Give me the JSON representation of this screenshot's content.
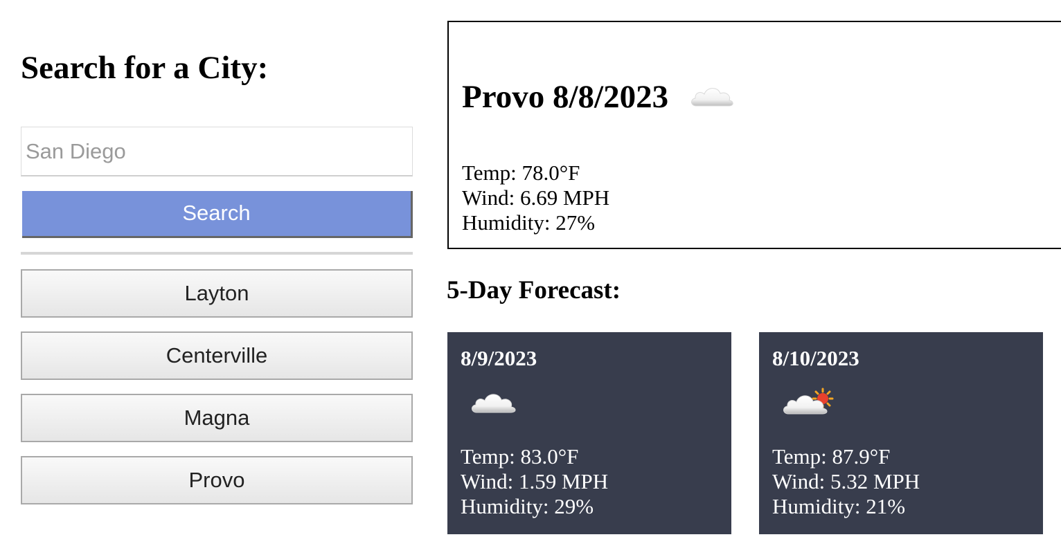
{
  "search": {
    "title": "Search for a City:",
    "placeholder": "San Diego",
    "value": "",
    "button_label": "Search"
  },
  "history": [
    {
      "label": "Layton"
    },
    {
      "label": "Centerville"
    },
    {
      "label": "Magna"
    },
    {
      "label": "Provo"
    }
  ],
  "current": {
    "title": "Provo 8/8/2023",
    "icon": "cloud-icon",
    "temp": "Temp: 78.0°F",
    "wind": "Wind: 6.69 MPH",
    "humidity": "Humidity: 27%"
  },
  "forecast": {
    "title": "5-Day Forecast:",
    "days": [
      {
        "date": "8/9/2023",
        "icon": "cloud-icon",
        "temp": "Temp: 83.0°F",
        "wind": "Wind: 1.59 MPH",
        "humidity": "Humidity: 29%"
      },
      {
        "date": "8/10/2023",
        "icon": "sun-behind-cloud-icon",
        "temp": "Temp: 87.9°F",
        "wind": "Wind: 5.32 MPH",
        "humidity": "Humidity: 21%"
      }
    ]
  },
  "colors": {
    "search_button": "#7892da",
    "forecast_card": "#383d4d"
  }
}
